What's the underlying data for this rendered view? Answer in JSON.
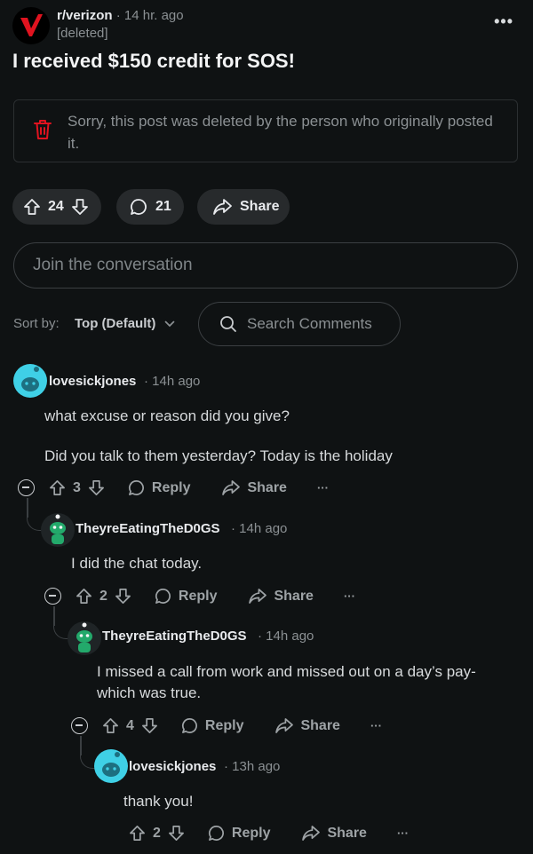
{
  "post": {
    "subreddit": "r/verizon",
    "dot": "·",
    "time": "14 hr. ago",
    "author": "[deleted]",
    "title": "I received $150 credit for SOS!",
    "deleted_notice": "Sorry, this post was deleted by the person who originally posted it.",
    "votes": "24",
    "comments": "21",
    "share": "Share",
    "subreddit_logo_letter": "V"
  },
  "join_placeholder": "Join the conversation",
  "sort": {
    "label": "Sort by:",
    "value": "Top (Default)"
  },
  "search_placeholder": "Search Comments",
  "comments": [
    {
      "user": "lovesickjones",
      "dot": "·",
      "time": "14h ago",
      "body1": "what excuse or reason did you give?",
      "body2": "Did you talk to them yesterday? Today is the holiday",
      "votes": "3",
      "reply": "Reply",
      "share": "Share",
      "more": "···"
    },
    {
      "user": "TheyreEatingTheD0GS",
      "dot": "·",
      "time": "14h ago",
      "body1": "I did the chat today.",
      "votes": "2",
      "reply": "Reply",
      "share": "Share",
      "more": "···"
    },
    {
      "user": "TheyreEatingTheD0GS",
      "dot": "·",
      "time": "14h ago",
      "body1": "I missed a call from work and missed out on a day’s pay- which was true.",
      "votes": "4",
      "reply": "Reply",
      "share": "Share",
      "more": "···"
    },
    {
      "user": "lovesickjones",
      "dot": "·",
      "time": "13h ago",
      "body1": "thank you!",
      "votes": "2",
      "reply": "Reply",
      "share": "Share",
      "more": "···"
    }
  ],
  "colors": {
    "background": "#0f1213",
    "brand_red": "#e0131f",
    "avatar_blue": "#3fd0e6",
    "avatar_green": "#23a96b"
  },
  "icons": [
    "trash-icon",
    "upvote-icon",
    "downvote-icon",
    "comment-icon",
    "share-icon",
    "search-icon",
    "chevron-down-icon",
    "collapse-icon",
    "menu-dots-icon"
  ]
}
